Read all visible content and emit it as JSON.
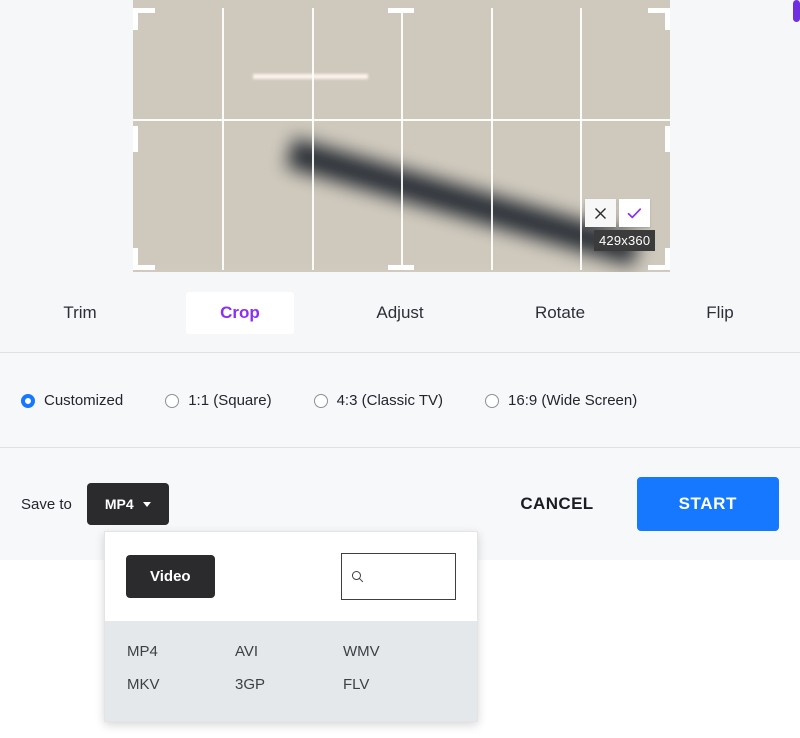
{
  "editor": {
    "crop_overlay": {
      "cancel_icon": "close-icon",
      "confirm_icon": "check-icon",
      "size_badge": "429x360",
      "accent_color": "#8b2ff5"
    }
  },
  "tabs": [
    {
      "label": "Trim",
      "active": false
    },
    {
      "label": "Crop",
      "active": true
    },
    {
      "label": "Adjust",
      "active": false
    },
    {
      "label": "Rotate",
      "active": false
    },
    {
      "label": "Flip",
      "active": false
    }
  ],
  "aspect_ratios": [
    {
      "label": "Customized",
      "selected": true
    },
    {
      "label": "1:1 (Square)",
      "selected": false
    },
    {
      "label": "4:3 (Classic TV)",
      "selected": false
    },
    {
      "label": "16:9 (Wide Screen)",
      "selected": false
    }
  ],
  "actions": {
    "save_to_label": "Save to",
    "format_value": "MP4",
    "cancel_label": "CANCEL",
    "start_label": "START",
    "start_color": "#1677ff"
  },
  "format_panel": {
    "category_label": "Video",
    "search_placeholder": "",
    "search_value": "",
    "search_icon": "search-icon",
    "formats": [
      "MP4",
      "AVI",
      "WMV",
      "MKV",
      "3GP",
      "FLV"
    ]
  }
}
